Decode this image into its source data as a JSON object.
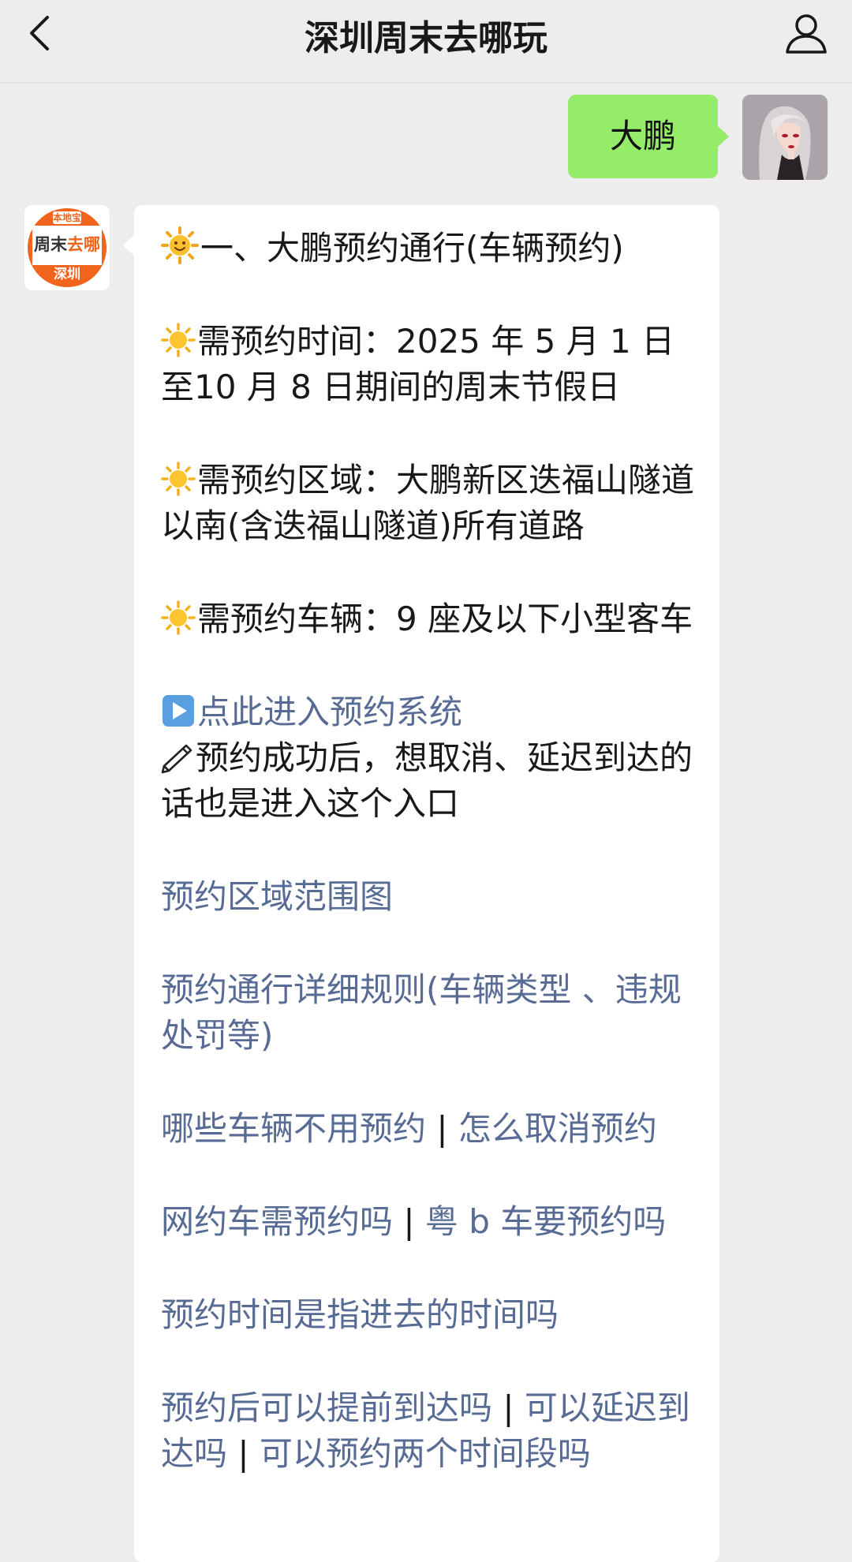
{
  "header": {
    "title": "深圳周末去哪玩",
    "back_icon": "chevron-left-icon",
    "profile_icon": "person-outline-icon"
  },
  "outgoing_message": {
    "text": "大鹏",
    "avatar": "user-avatar-illustration"
  },
  "incoming_message": {
    "avatar_brand_top": "本地宝",
    "avatar_brand_main_a": "周末",
    "avatar_brand_main_b": "去哪",
    "avatar_brand_bottom": "深圳",
    "heading": "一、大鹏预约通行(车辆预约)",
    "time_label": "需预约时间：2025 年 5 月 1 日至10 月 8 日期间的周末节假日",
    "area_label": "需预约区域：大鹏新区迭福山隧道以南(含迭福山隧道)所有道路",
    "vehicle_label": "需预约车辆：9 座及以下小型客车",
    "entry_link": "点此进入预约系统",
    "entry_note": "预约成功后，想取消、延迟到达的话也是进入这个入口",
    "link_map": "预约区域范围图",
    "link_rules": "预约通行详细规则(车辆类型 、违规处罚等)",
    "link_no_reserve": "哪些车辆不用预约",
    "link_cancel": "怎么取消预约",
    "link_ride_hailing": "网约车需预约吗",
    "link_yue_b": "粤 b 车要预约吗",
    "link_time_meaning": "预约时间是指进去的时间吗",
    "link_early": "预约后可以提前到达吗",
    "link_late_a": "可以延迟",
    "link_late_b": "到达吗",
    "link_two_slots": "可以预约两个时间段吗",
    "separator": "|"
  },
  "colors": {
    "background": "#ededed",
    "outgoing_bubble": "#95ec69",
    "incoming_bubble": "#ffffff",
    "link": "#576b95",
    "brand_orange": "#f0641e"
  }
}
